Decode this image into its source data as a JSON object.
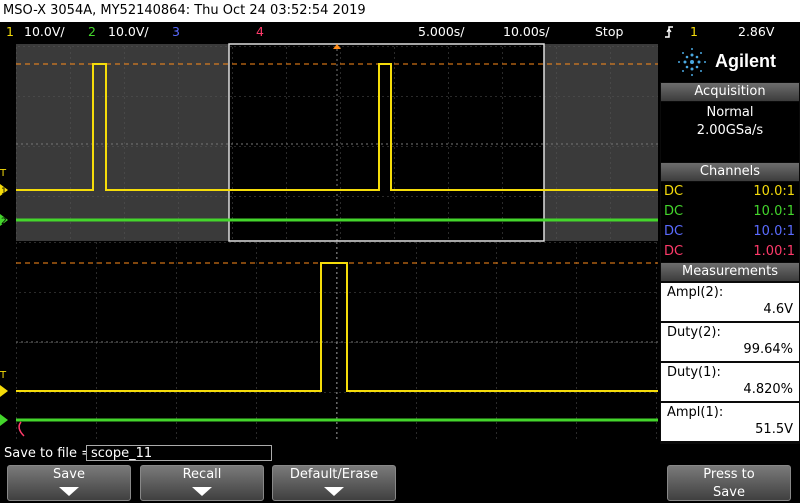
{
  "title_bar": "MSO-X 3054A, MY52140864: Thu Oct 24 03:52:54 2019",
  "status": {
    "ch1_num": "1",
    "ch1_scale": "10.0V/",
    "ch2_num": "2",
    "ch2_scale": "10.0V/",
    "ch3_num": "3",
    "ch4_num": "4",
    "timebase_zoom": "5.000s/",
    "timebase_main": "10.00s/",
    "run_state": "Stop",
    "trigger_icon": "trigger-edge-icon",
    "trigger_channel": "1",
    "trigger_level": "2.86V"
  },
  "brand": "Agilent",
  "acquisition": {
    "header": "Acquisition",
    "mode": "Normal",
    "rate": "2.00GSa/s"
  },
  "channels": {
    "header": "Channels",
    "items": [
      {
        "coupling": "DC",
        "ratio": "10.0:1",
        "color": "#f5dc0a"
      },
      {
        "coupling": "DC",
        "ratio": "10.0:1",
        "color": "#44d62c"
      },
      {
        "coupling": "DC",
        "ratio": "10.0:1",
        "color": "#5a6bff"
      },
      {
        "coupling": "DC",
        "ratio": "1.00:1",
        "color": "#ff3a6a"
      }
    ]
  },
  "measurements": {
    "header": "Measurements",
    "items": [
      {
        "label": "Ampl(2):",
        "value": "4.6V"
      },
      {
        "label": "Duty(2):",
        "value": "99.64%"
      },
      {
        "label": "Duty(1):",
        "value": "4.820%"
      },
      {
        "label": "Ampl(1):",
        "value": "51.5V"
      }
    ]
  },
  "save_to_file": {
    "label": "Save to file =",
    "value": "scope_11"
  },
  "softkeys": {
    "save": "Save",
    "recall": "Recall",
    "default_erase": "Default/Erase",
    "press_to": "Press to",
    "press_save": "Save"
  },
  "ground_markers": {
    "ch1": "1",
    "ch2": "2",
    "trigger_marker": "T"
  },
  "colors": {
    "ch1": "#f5dc0a",
    "ch2": "#44d62c",
    "ch3": "#5a6bff",
    "ch4": "#ff3a6a",
    "trigger": "#ff8c1a"
  }
}
